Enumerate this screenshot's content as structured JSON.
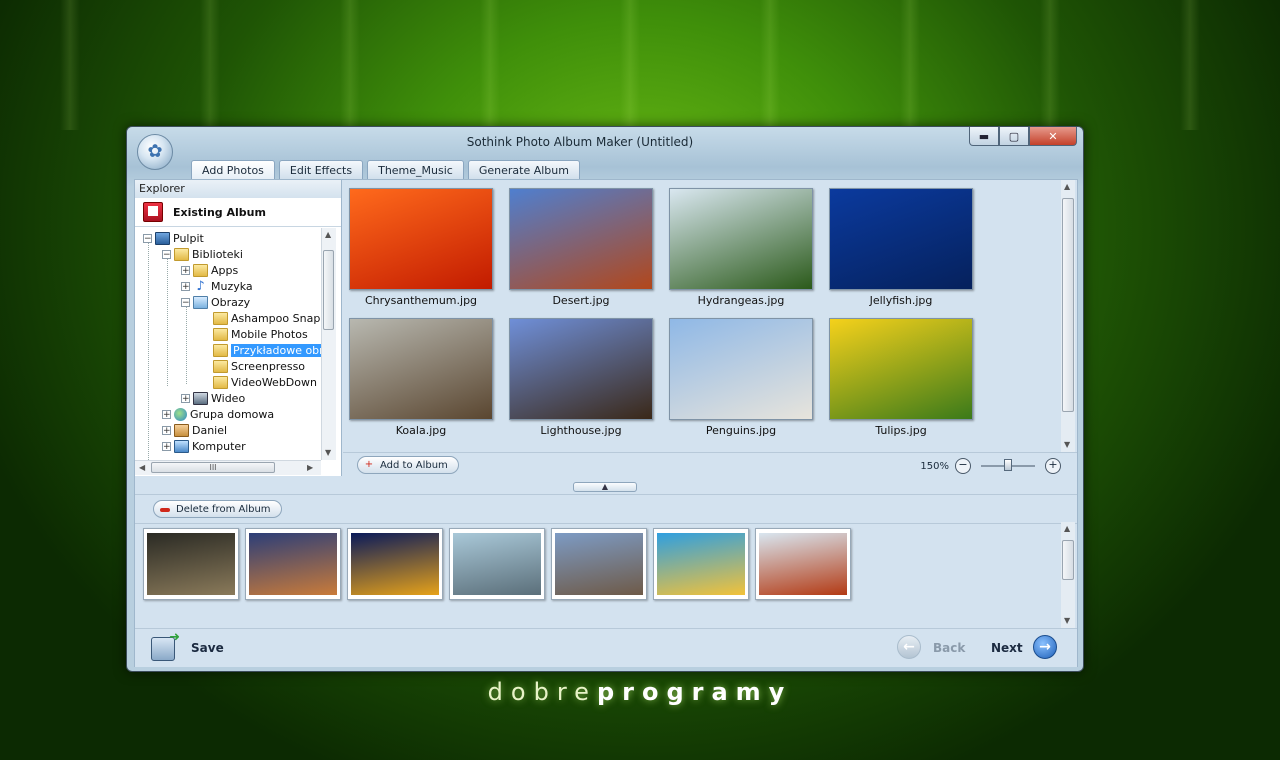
{
  "window": {
    "title": "Sothink Photo Album Maker (Untitled)",
    "min_glyph": "▬",
    "max_glyph": "▢",
    "close_glyph": "✕"
  },
  "tabs": [
    {
      "label": "Add Photos",
      "active": true
    },
    {
      "label": "Edit Effects",
      "active": false
    },
    {
      "label": "Theme_Music",
      "active": false
    },
    {
      "label": "Generate Album",
      "active": false
    }
  ],
  "explorer": {
    "header": "Explorer",
    "existing_album": "Existing Album",
    "tree": [
      {
        "label": "Pulpit",
        "icon": "desktop-icon"
      },
      {
        "label": "Biblioteki",
        "icon": "folder-icon"
      },
      {
        "label": "Apps",
        "icon": "folder-icon"
      },
      {
        "label": "Muzyka",
        "icon": "music-icon"
      },
      {
        "label": "Obrazy",
        "icon": "pictures-icon"
      },
      {
        "label": "Ashampoo Snap",
        "icon": "folder-icon"
      },
      {
        "label": "Mobile Photos",
        "icon": "folder-icon"
      },
      {
        "label": "Przykładowe obr",
        "icon": "folder-icon",
        "selected": true
      },
      {
        "label": "Screenpresso",
        "icon": "folder-icon"
      },
      {
        "label": "VideoWebDown",
        "icon": "folder-icon"
      },
      {
        "label": "Wideo",
        "icon": "video-icon"
      },
      {
        "label": "Grupa domowa",
        "icon": "homegroup-icon"
      },
      {
        "label": "Daniel",
        "icon": "user-icon"
      },
      {
        "label": "Komputer",
        "icon": "computer-icon"
      }
    ],
    "hscroll_grip": "III"
  },
  "photos": [
    {
      "name": "Chrysanthemum.jpg",
      "colors": [
        "#ff6a1c",
        "#c21b00"
      ]
    },
    {
      "name": "Desert.jpg",
      "colors": [
        "#4f7fcf",
        "#b2471b"
      ]
    },
    {
      "name": "Hydrangeas.jpg",
      "colors": [
        "#d9e7f0",
        "#2b5a1a"
      ]
    },
    {
      "name": "Jellyfish.jpg",
      "colors": [
        "#0b3a9e",
        "#05215c"
      ]
    },
    {
      "name": "Koala.jpg",
      "colors": [
        "#b8b8b0",
        "#5a4630"
      ]
    },
    {
      "name": "Lighthouse.jpg",
      "colors": [
        "#6f8fd8",
        "#3a2818"
      ]
    },
    {
      "name": "Penguins.jpg",
      "colors": [
        "#8fb8e6",
        "#e7e4dc"
      ]
    },
    {
      "name": "Tulips.jpg",
      "colors": [
        "#f5d11b",
        "#3b7a1a"
      ]
    }
  ],
  "grid_footer": {
    "add_to_album": "Add to Album",
    "zoom_level": "150%",
    "zoom_out": "−",
    "zoom_in": "+"
  },
  "album": {
    "delete_label": "Delete from Album",
    "thumbs": [
      {
        "colors": [
          "#2a2a24",
          "#8a7a5a"
        ]
      },
      {
        "colors": [
          "#2c3e78",
          "#c97b3a"
        ]
      },
      {
        "colors": [
          "#0a1a5a",
          "#e6a21a"
        ]
      },
      {
        "colors": [
          "#a9c8d8",
          "#5b6f7a"
        ]
      },
      {
        "colors": [
          "#7d9bc4",
          "#6e5a48"
        ]
      },
      {
        "colors": [
          "#2f9fe0",
          "#f2c23a"
        ]
      },
      {
        "colors": [
          "#d9e6f0",
          "#b33a14"
        ]
      }
    ]
  },
  "bottom": {
    "save_label": "Save",
    "back_label": "Back",
    "next_label": "Next",
    "back_arrow": "←",
    "next_arrow": "→"
  },
  "desktop": {
    "logo_light": "dobre",
    "logo_bold": "programy"
  }
}
